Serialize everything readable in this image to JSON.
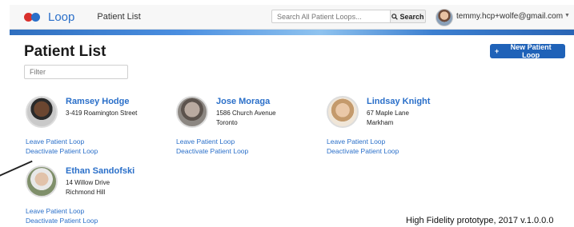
{
  "nav": {
    "app_name": "Loop",
    "page_link": "Patient List",
    "search_placeholder": "Search All Patient Loops...",
    "search_button": "Search",
    "user_email": "temmy.hcp+wolfe@gmail.com"
  },
  "page": {
    "title": "Patient List",
    "filter_placeholder": "Filter",
    "new_button": "New Patient Loop"
  },
  "patients": [
    {
      "name": "Ramsey Hodge",
      "address": [
        "3-419 Roamington Street"
      ],
      "leave": "Leave Patient Loop",
      "deactivate": "Deactivate Patient Loop"
    },
    {
      "name": "Jose Moraga",
      "address": [
        "1586 Church Avenue",
        "Toronto"
      ],
      "leave": "Leave Patient Loop",
      "deactivate": "Deactivate Patient Loop"
    },
    {
      "name": "Lindsay Knight",
      "address": [
        "67 Maple Lane",
        "Markham"
      ],
      "leave": "Leave Patient Loop",
      "deactivate": "Deactivate Patient Loop"
    },
    {
      "name": "Ethan Sandofski",
      "address": [
        "14 Willow Drive",
        "Richmond Hill"
      ],
      "leave": "Leave Patient Loop",
      "deactivate": "Deactivate Patient Loop"
    }
  ],
  "footnote": "High Fidelity prototype, 2017 v.1.0.0.0",
  "colors": {
    "brand_blue": "#2a6fc9",
    "brand_red": "#d9302c",
    "button_blue": "#1f62b8"
  }
}
